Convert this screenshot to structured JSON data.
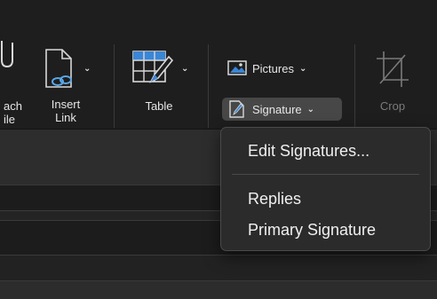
{
  "ribbon": {
    "attach_file": {
      "line1": "ach",
      "line2": "ile",
      "icon": "paperclip-icon"
    },
    "insert_link": {
      "line1": "Insert",
      "line2": "Link",
      "icon": "link-icon"
    },
    "table": {
      "label": "Table",
      "icon": "table-icon"
    },
    "pictures": {
      "label": "Pictures",
      "icon": "pictures-icon"
    },
    "signature": {
      "label": "Signature",
      "icon": "signature-icon"
    },
    "crop": {
      "label": "Crop",
      "icon": "crop-icon",
      "disabled": true
    }
  },
  "signature_menu": {
    "items_top": [
      "Edit Signatures..."
    ],
    "items_bottom": [
      "Replies",
      "Primary Signature"
    ]
  },
  "colors": {
    "ribbon_bg": "#1e1e1e",
    "menu_bg": "#2b2b2b",
    "text": "#e6e6e6",
    "disabled_text": "#7a7a7a",
    "table_icon_blue": "#3a86d6"
  }
}
